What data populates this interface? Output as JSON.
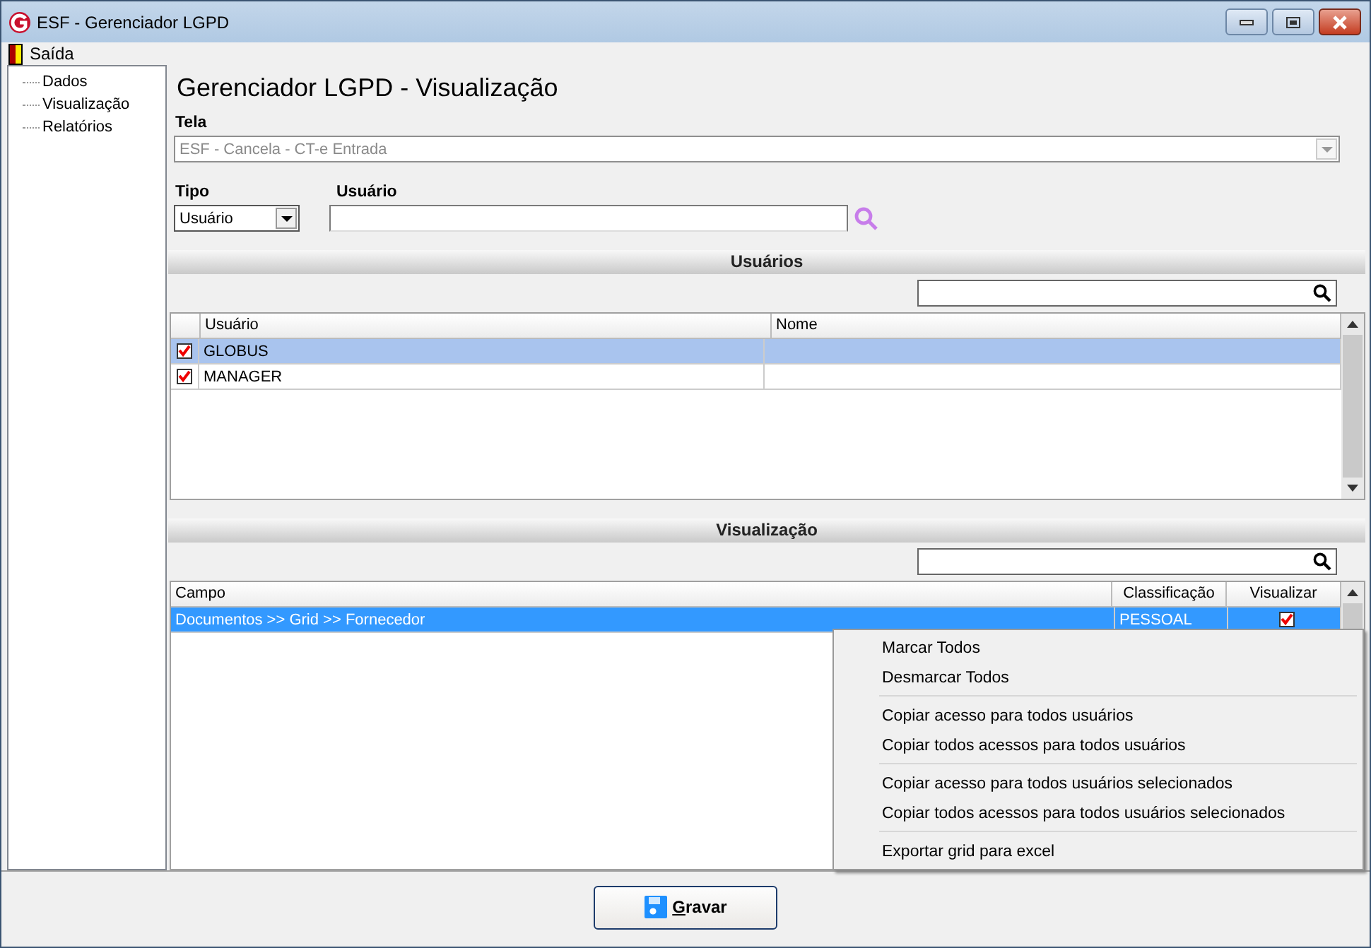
{
  "window": {
    "title": "ESF - Gerenciador LGPD"
  },
  "menu": [
    {
      "label": "Saída"
    }
  ],
  "sidebar": {
    "items": [
      {
        "label": "Dados"
      },
      {
        "label": "Visualização"
      },
      {
        "label": "Relatórios"
      }
    ]
  },
  "page_title": "Gerenciador LGPD - Visualização",
  "tela": {
    "label": "Tela",
    "value": "ESF - Cancela - CT-e Entrada",
    "disabled": true
  },
  "tipo": {
    "label": "Tipo",
    "value": "Usuário"
  },
  "usuario": {
    "label": "Usuário"
  },
  "users_section": {
    "title": "Usuários",
    "columns": [
      "Usuário",
      "Nome"
    ],
    "rows": [
      {
        "usuario": "GLOBUS",
        "checked": true,
        "selected": true
      },
      {
        "usuario": "MANAGER",
        "checked": true,
        "selected": false
      }
    ]
  },
  "view_section": {
    "title": "Visualização",
    "columns": [
      "Campo",
      "Classificação",
      "Visualizar"
    ],
    "rows": [
      {
        "campo": "Documentos >> Grid >> Fornecedor",
        "classificacao": "PESSOAL",
        "visualizar": true,
        "selected": true
      }
    ]
  },
  "context_menu": {
    "groups": [
      [
        "Marcar Todos",
        "Desmarcar Todos"
      ],
      [
        "Copiar acesso para todos usuários",
        "Copiar todos acessos para todos usuários"
      ],
      [
        "Copiar acesso para todos usuários selecionados",
        "Copiar todos acessos para todos usuários selecionados"
      ],
      [
        "Exportar grid para excel"
      ]
    ]
  },
  "save_button": {
    "label": "Gravar"
  }
}
